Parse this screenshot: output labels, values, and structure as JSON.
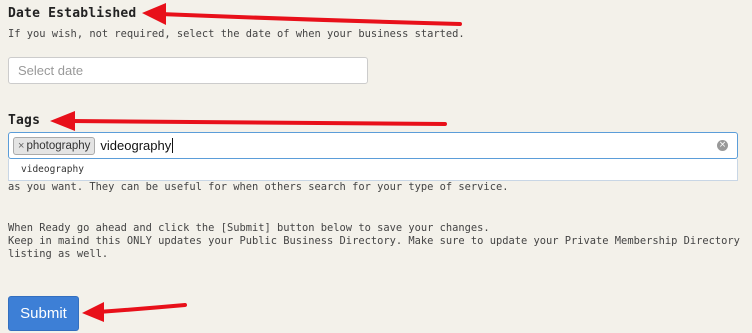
{
  "date_section": {
    "label": "Date Established",
    "help": "If you wish, not required, select the date of when your business started.",
    "placeholder": "Select date"
  },
  "tags_section": {
    "label": "Tags",
    "chips": [
      {
        "remove": "×",
        "label": "photography"
      }
    ],
    "typed_value": "videography",
    "suggestion": "videography",
    "help_partial": "as you want. They can be useful for when others search for your type of service."
  },
  "instructions": {
    "line1": "When Ready go ahead and click the [Submit] button below to save your changes.",
    "line2": "Keep in maind this ONLY updates your Public Business Directory. Make sure to update your Private Membership Directory",
    "line3": "listing as well."
  },
  "submit": {
    "label": "Submit"
  },
  "colors": {
    "background": "#f3f1ea",
    "annotation_arrow": "#e8101a",
    "submit_button": "#3d7fd6",
    "focus_border": "#5b9dd9"
  },
  "icons": {
    "clear": "clear-circle-icon",
    "chip_remove": "close-icon"
  }
}
